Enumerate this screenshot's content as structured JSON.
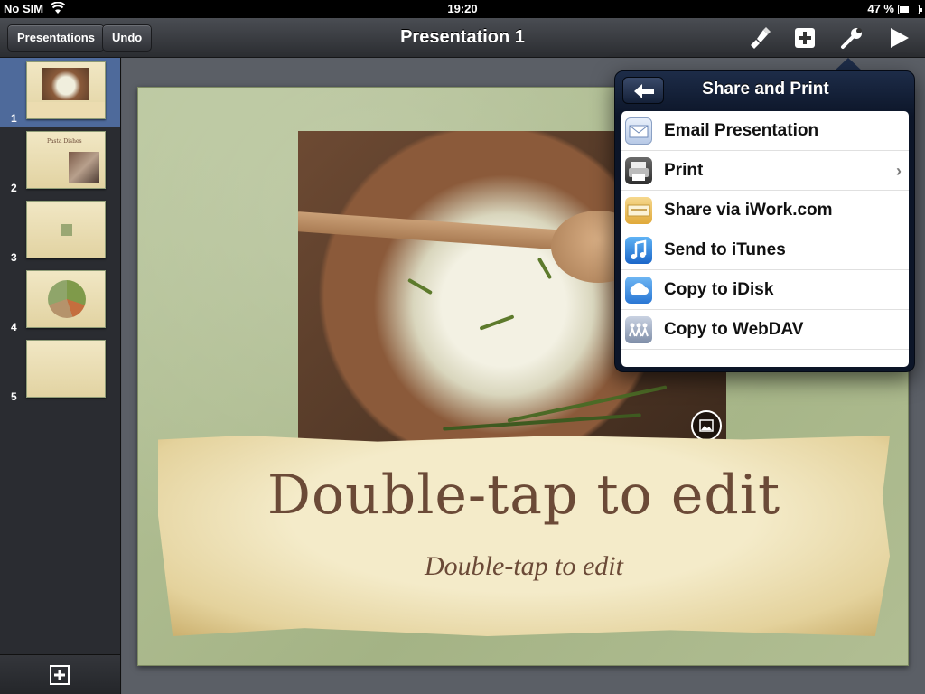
{
  "status_bar": {
    "carrier": "No SIM",
    "time": "19:20",
    "battery": "47 %"
  },
  "toolbar": {
    "presentations_label": "Presentations",
    "undo_label": "Undo",
    "title": "Presentation 1",
    "icons": [
      "format-brush-icon",
      "insert-plus-icon",
      "tools-wrench-icon",
      "play-icon"
    ]
  },
  "sidebar": {
    "slides": [
      {
        "number": "1",
        "selected": true
      },
      {
        "number": "2",
        "caption": "Pasta Dishes"
      },
      {
        "number": "3"
      },
      {
        "number": "4"
      },
      {
        "number": "5"
      }
    ]
  },
  "slide": {
    "title": "Double-tap to edit",
    "subtitle": "Double-tap to edit"
  },
  "popover": {
    "title": "Share and Print",
    "items": [
      {
        "label": "Email Presentation",
        "icon": "mail-icon",
        "has_chevron": false
      },
      {
        "label": "Print",
        "icon": "printer-icon",
        "has_chevron": true
      },
      {
        "label": "Share via iWork.com",
        "icon": "iwork-icon",
        "has_chevron": false
      },
      {
        "label": "Send to iTunes",
        "icon": "itunes-icon",
        "has_chevron": false
      },
      {
        "label": "Copy to iDisk",
        "icon": "idisk-icon",
        "has_chevron": false
      },
      {
        "label": "Copy to WebDAV",
        "icon": "webdav-icon",
        "has_chevron": false
      }
    ],
    "chevron": "›"
  },
  "colors": {
    "selection": "#4e6a9b",
    "popover": "#0c1528",
    "slide_text": "#6b4a37"
  }
}
